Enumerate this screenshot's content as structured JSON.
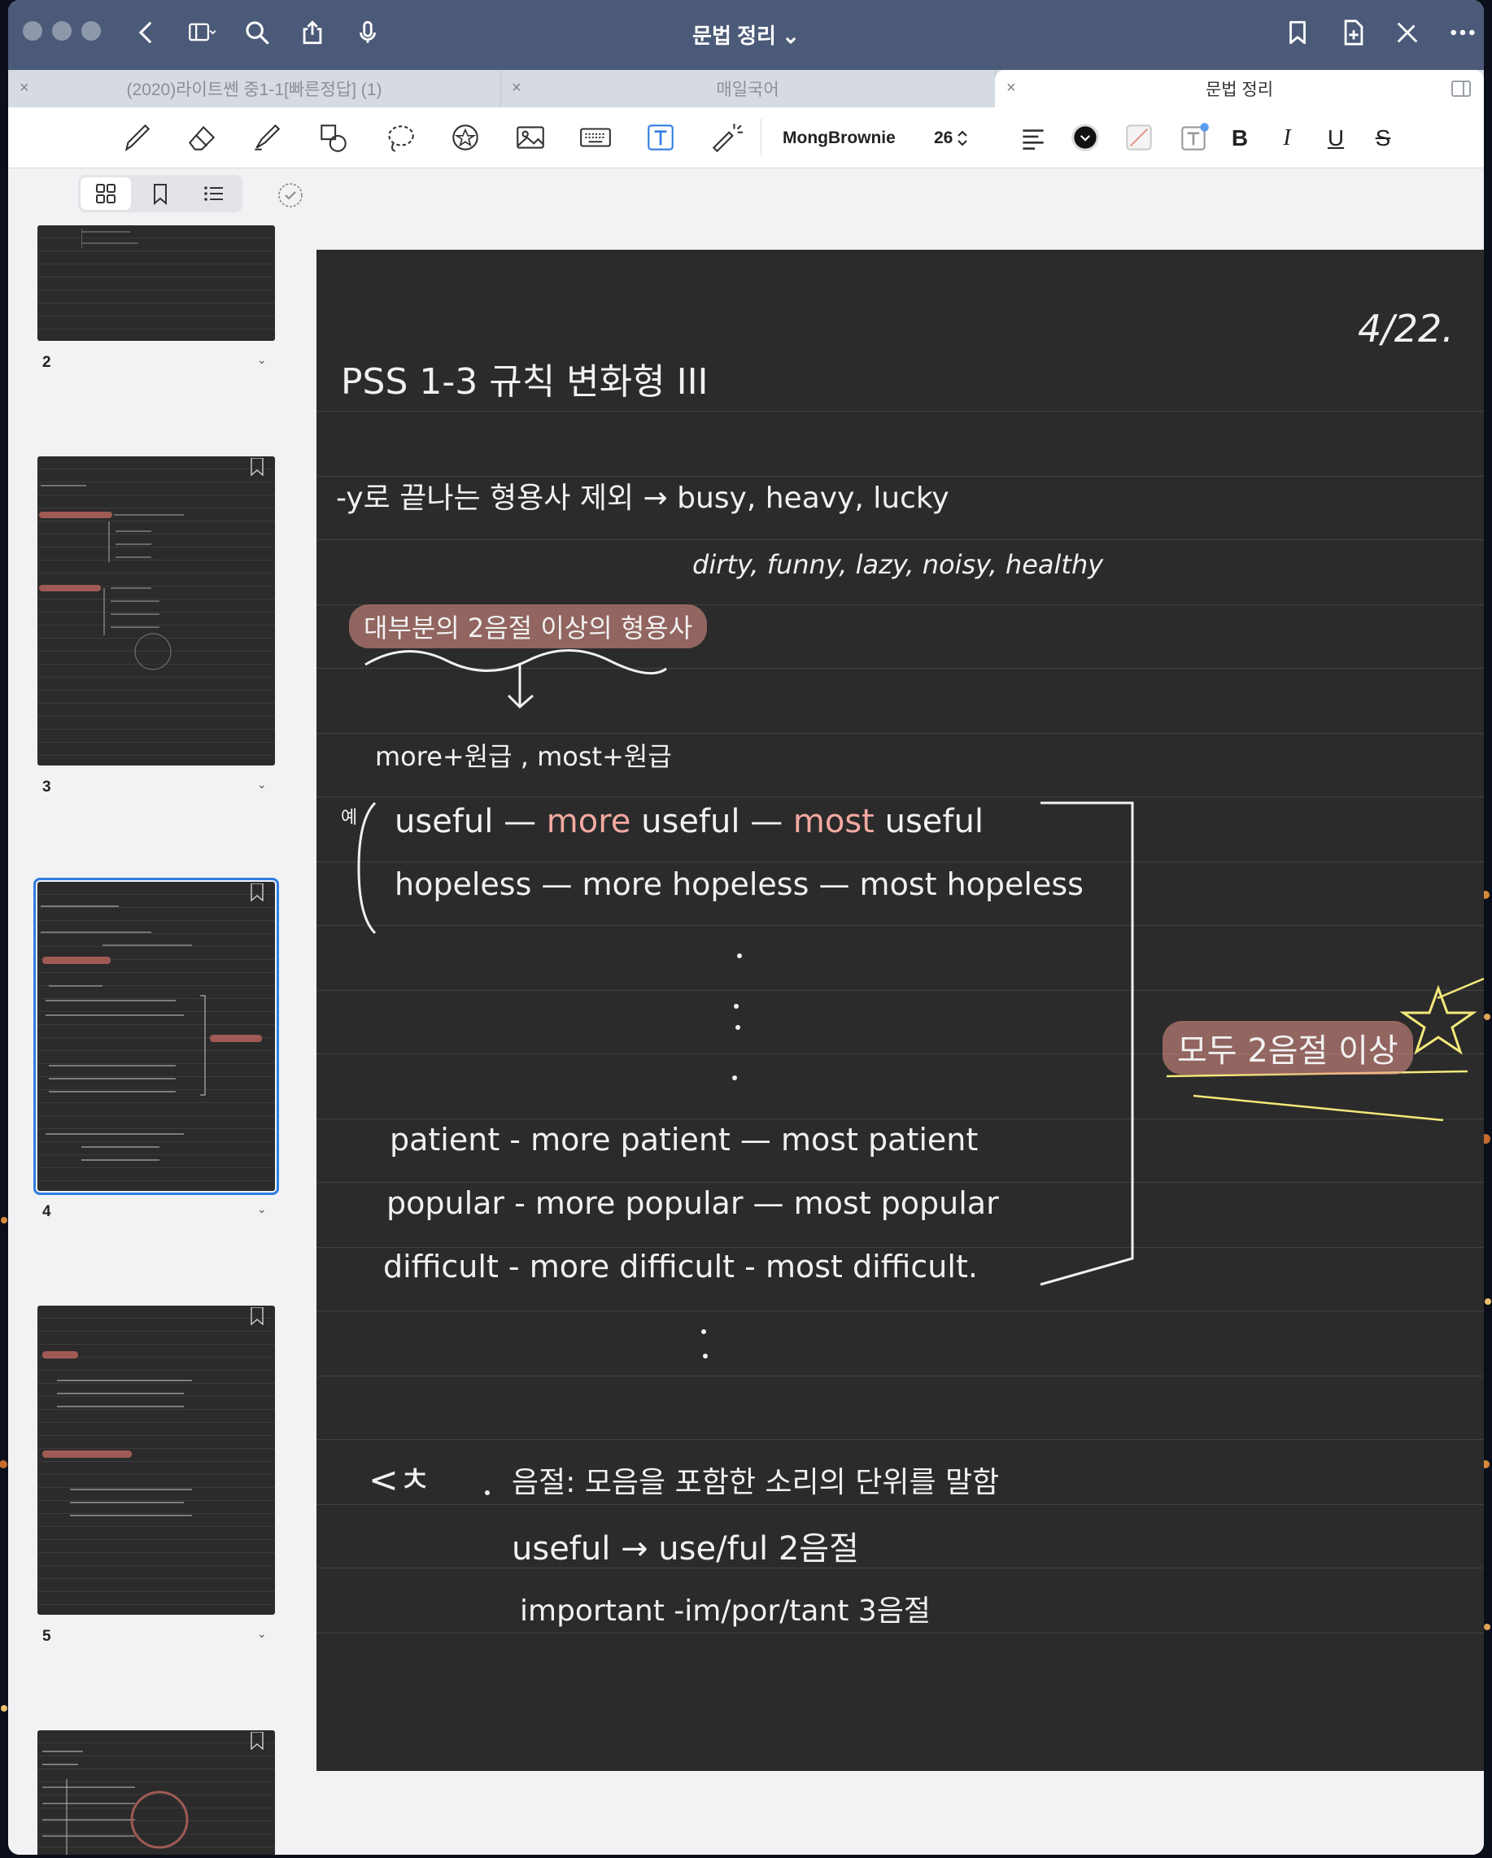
{
  "window": {
    "title": "문법 정리 ⌄"
  },
  "tabs": [
    {
      "label": "(2020)라이트쎈 중1-1[빠른정답] (1)",
      "active": false
    },
    {
      "label": "매일국어",
      "active": false
    },
    {
      "label": "문법 정리",
      "active": true
    }
  ],
  "toolbar": {
    "font_name": "MongBrownie",
    "font_size": "26",
    "bold": "B",
    "italic": "I",
    "underline": "U",
    "strike": "S"
  },
  "sidebar": {
    "pages": [
      {
        "number": "2"
      },
      {
        "number": "3"
      },
      {
        "number": "4",
        "selected": true
      },
      {
        "number": "5"
      }
    ]
  },
  "note": {
    "date": "4/22.",
    "heading": "PSS 1-3 규칙 변화형 III",
    "line1": "-y로 끝나는 형용사 제외 → busy, heavy, lucky",
    "line2": "dirty, funny, lazy, noisy, healthy",
    "highlight_rule": "대부분의 2음절 이상의 형용사",
    "form": "more+원급 , most+원급",
    "ex_label": "예",
    "ex1": {
      "a": "useful —",
      "b": "more",
      "c": "useful —",
      "d": "most",
      "e": "useful"
    },
    "ex2": "hopeless — more hopeless — most hopeless",
    "ex3": "patient - more patient — most patient",
    "ex4": "popular - more popular — most popular",
    "ex5": "difficult - more difficult - most difficult.",
    "side_note": "모두 2음절 이상",
    "ref_label": "<ㅊ",
    "ref1": "음절: 모음을 포함한 소리의 단위를 말함",
    "ref2": "useful → use/ful 2음절",
    "ref3": "important -im/por/tant 3음절"
  },
  "colors": {
    "titlebar": "#4b5a78",
    "page": "#2b2b2b",
    "highlight": "#e8968c",
    "star": "#f3e97a",
    "selection": "#2f7de1"
  }
}
